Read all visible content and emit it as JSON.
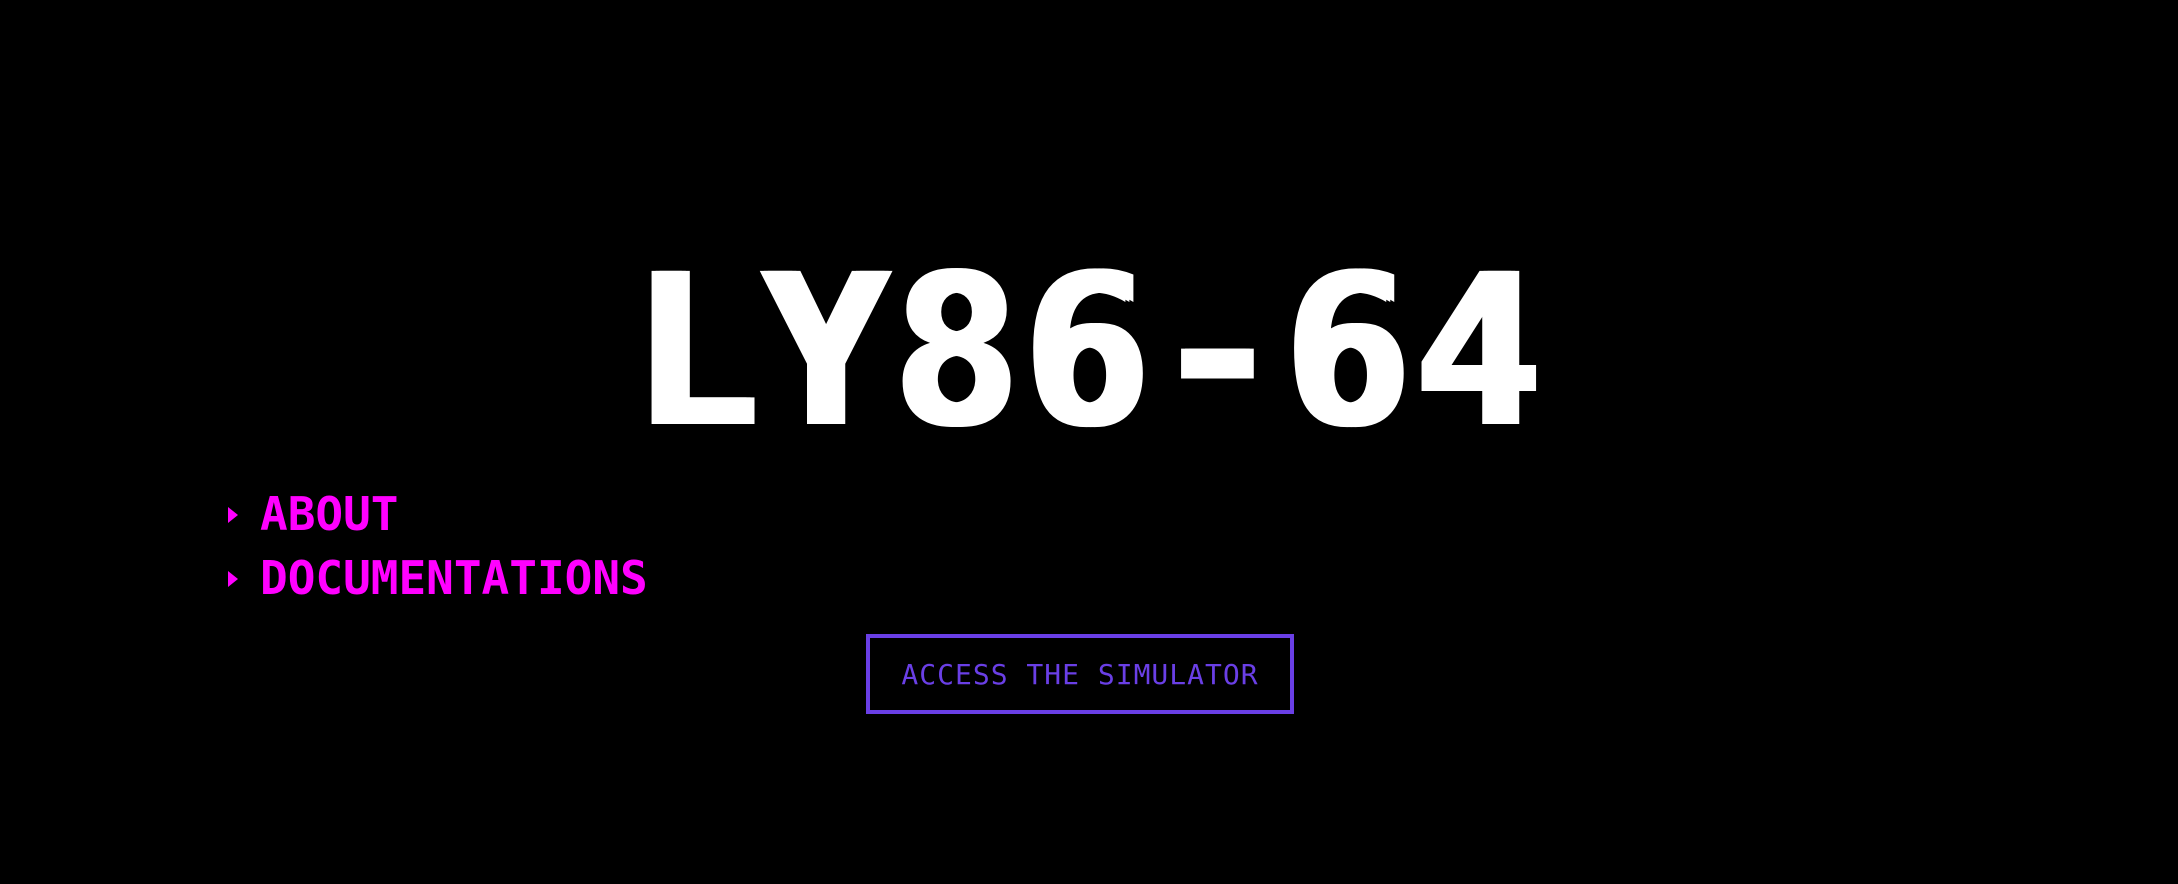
{
  "title": "LY86-64",
  "nav": {
    "items": [
      {
        "label": "ABOUT",
        "icon": "caret-right-icon"
      },
      {
        "label": "DOCUMENTATIONS",
        "icon": "caret-right-icon"
      }
    ]
  },
  "cta": {
    "label": "ACCESS THE SIMULATOR"
  },
  "colors": {
    "background": "#000000",
    "title": "#ffffff",
    "nav": "#ff00ff",
    "accent": "#6a3fe6"
  }
}
